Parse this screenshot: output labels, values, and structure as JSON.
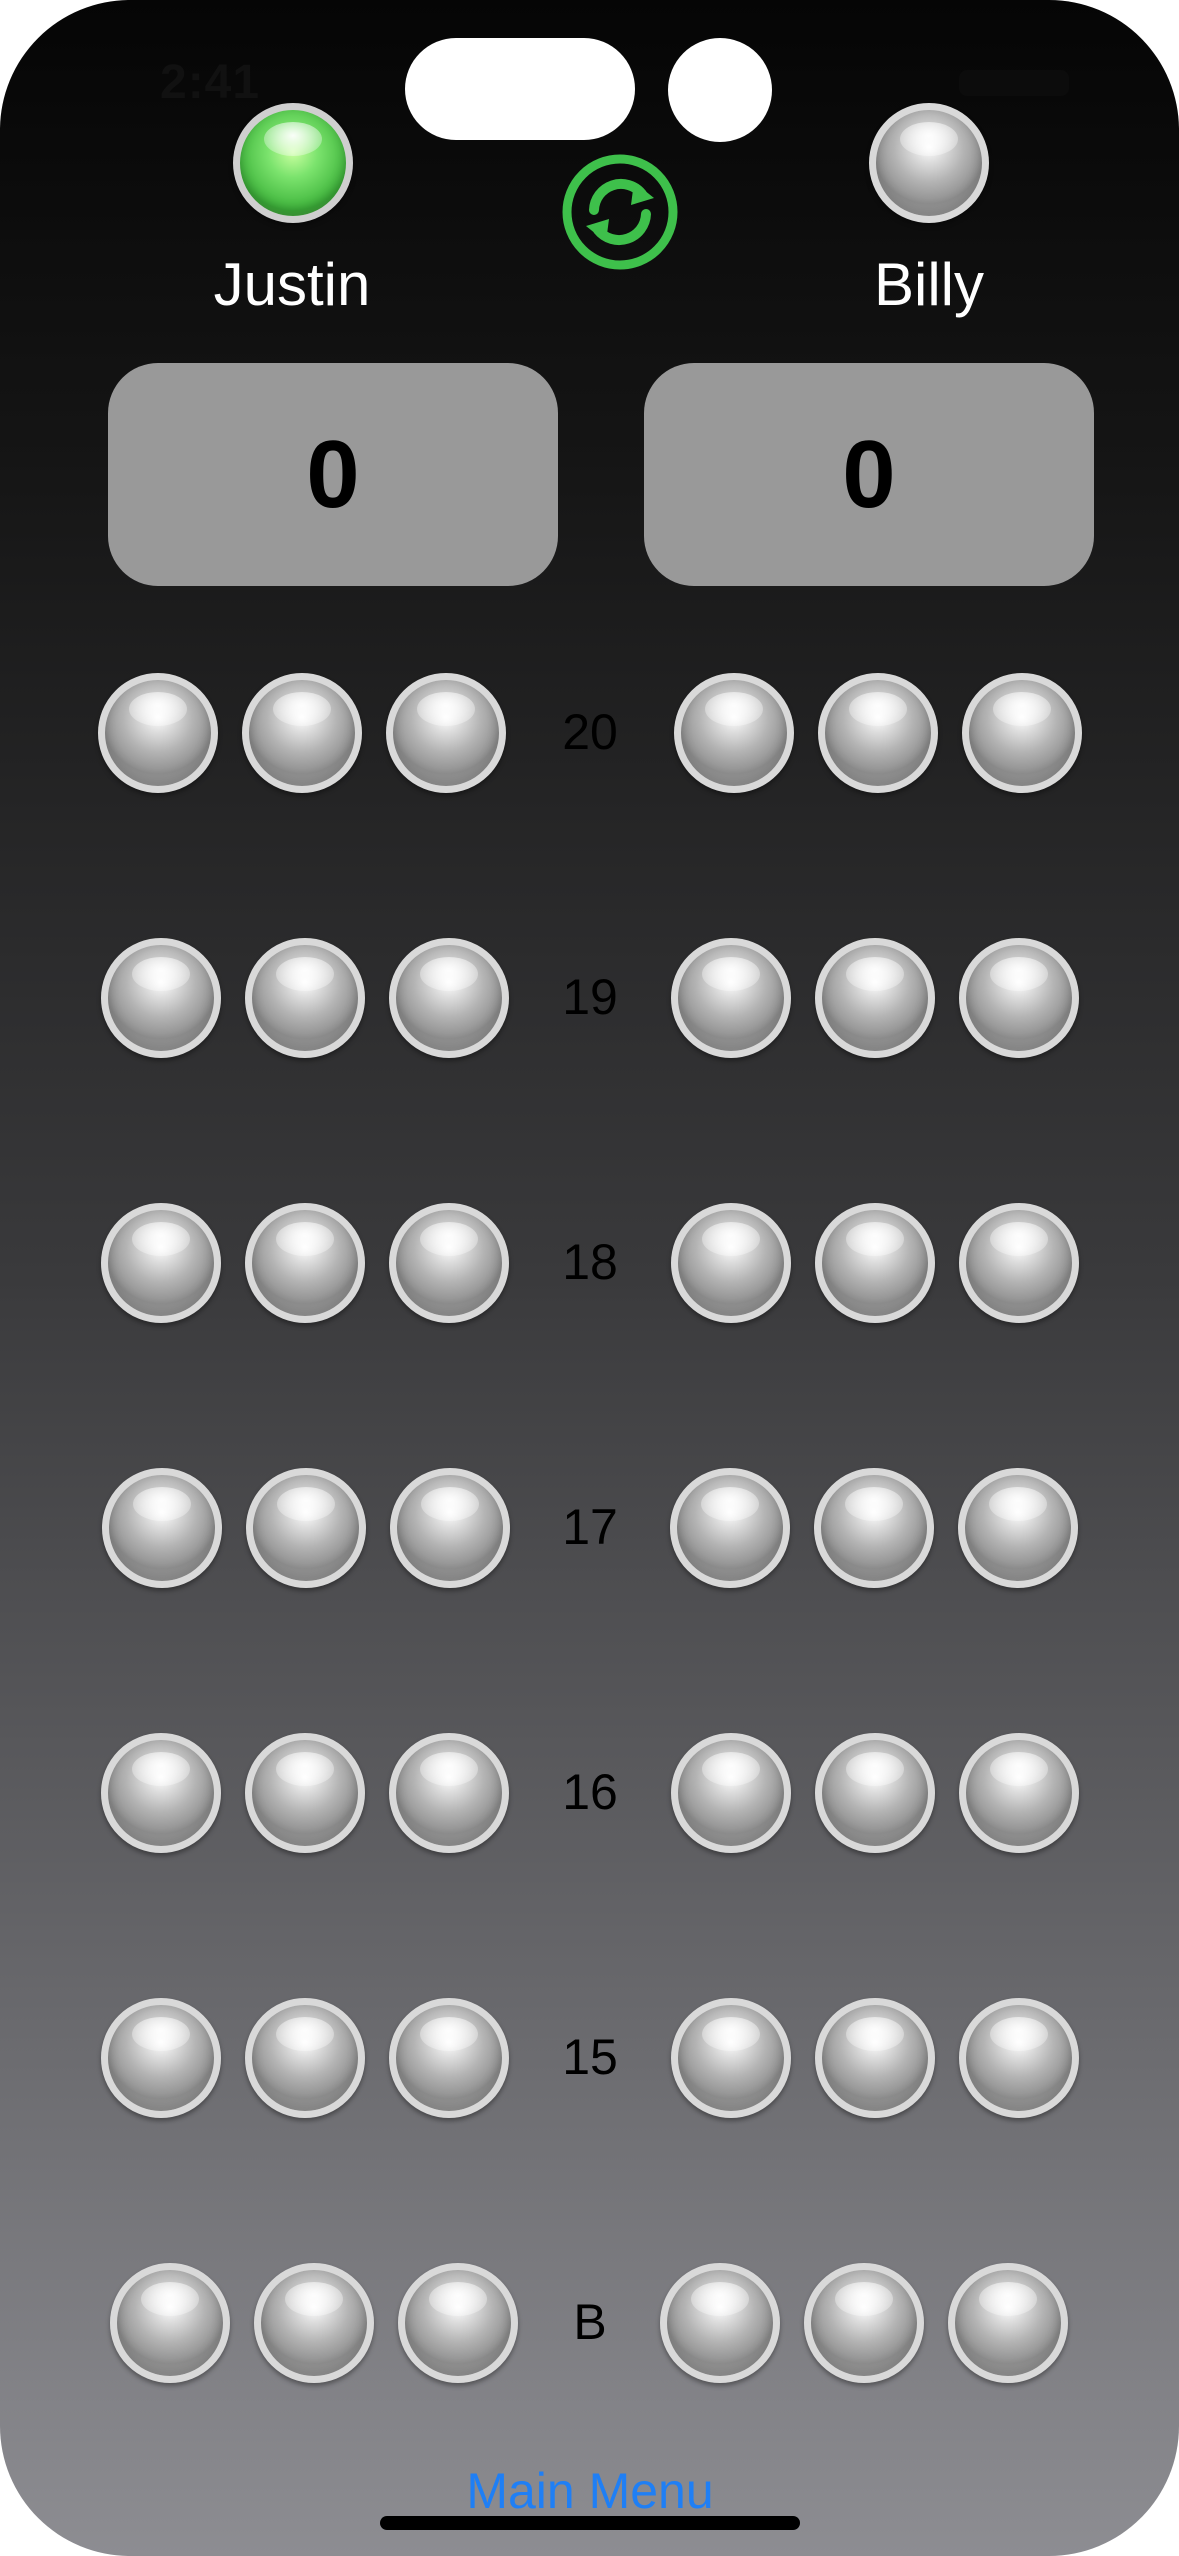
{
  "status": {
    "time": "2:41"
  },
  "players": [
    {
      "name": "Justin",
      "score": "0",
      "active": true
    },
    {
      "name": "Billy",
      "score": "0",
      "active": false
    }
  ],
  "controls": {
    "refresh_icon": "refresh-icon",
    "main_menu_label": "Main Menu"
  },
  "board": {
    "rows": [
      {
        "label": "20",
        "justin_marks": 0,
        "billy_marks": 0
      },
      {
        "label": "19",
        "justin_marks": 0,
        "billy_marks": 0
      },
      {
        "label": "18",
        "justin_marks": 0,
        "billy_marks": 0
      },
      {
        "label": "17",
        "justin_marks": 0,
        "billy_marks": 0
      },
      {
        "label": "16",
        "justin_marks": 0,
        "billy_marks": 0
      },
      {
        "label": "15",
        "justin_marks": 0,
        "billy_marks": 0
      },
      {
        "label": "B",
        "justin_marks": 0,
        "billy_marks": 0
      }
    ]
  },
  "colors": {
    "accent": "#1f7ff5",
    "active_player": "#3ec04b",
    "score_box": "#999999"
  }
}
